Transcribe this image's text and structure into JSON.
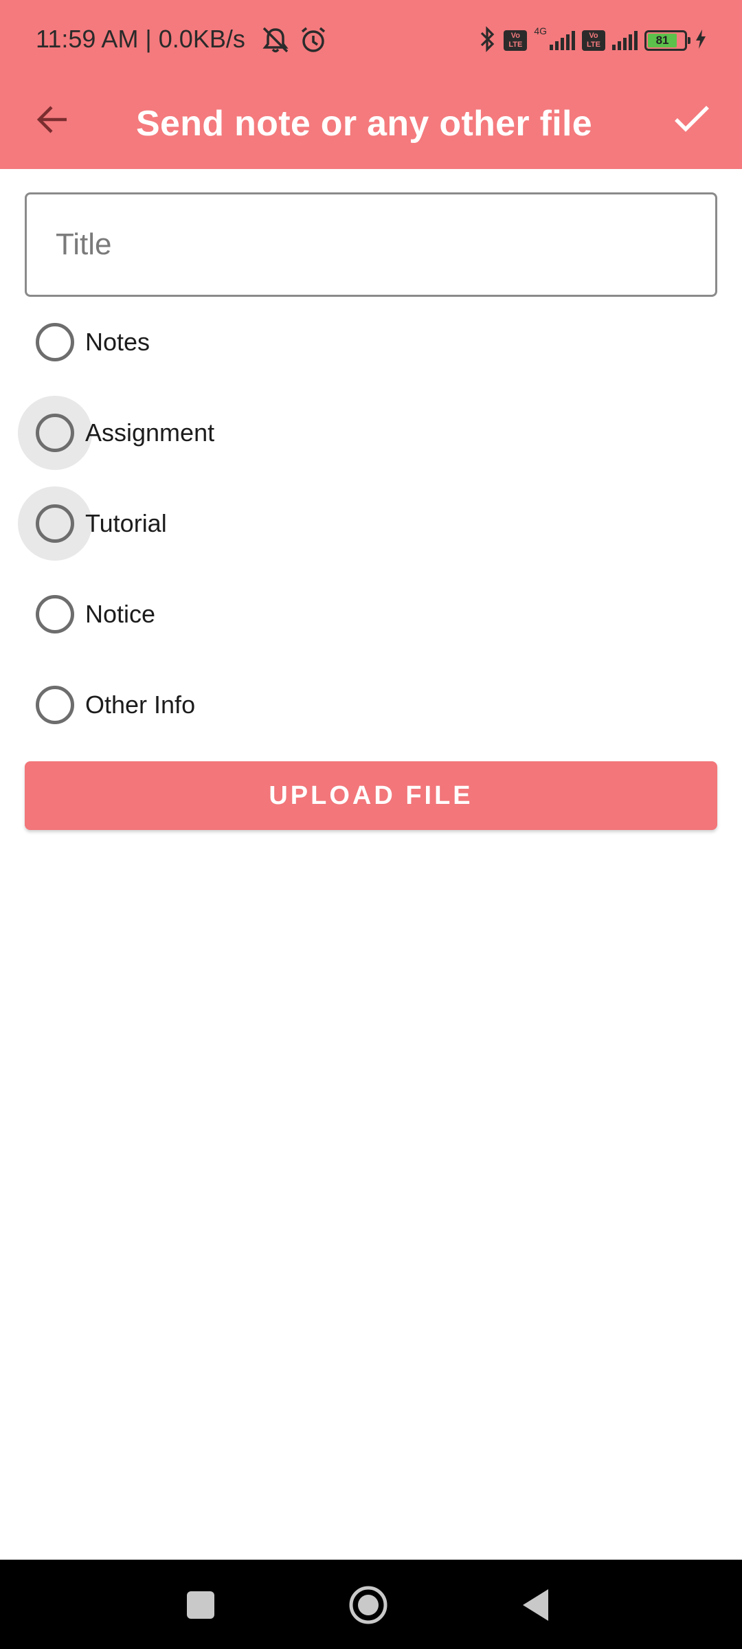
{
  "status_bar": {
    "time": "11:59 AM | 0.0KB/s",
    "network_label": "4G",
    "volte_label": "Vo LTE",
    "battery_level": "81"
  },
  "app_bar": {
    "title": "Send note or any other file"
  },
  "form": {
    "title_placeholder": "Title",
    "title_value": ""
  },
  "categories": [
    {
      "label": "Notes",
      "selected": false
    },
    {
      "label": "Assignment",
      "selected": false
    },
    {
      "label": "Tutorial",
      "selected": false
    },
    {
      "label": "Notice",
      "selected": false
    },
    {
      "label": "Other Info",
      "selected": false
    }
  ],
  "actions": {
    "upload_label": "UPLOAD FILE"
  },
  "colors": {
    "primary": "#f47a7d",
    "button": "#f2767a",
    "on_primary": "#ffffff"
  },
  "icons": {
    "back": "arrow-back-icon",
    "confirm": "check-icon",
    "nav_recent": "square-icon",
    "nav_home": "circle-icon",
    "nav_back": "triangle-back-icon"
  }
}
